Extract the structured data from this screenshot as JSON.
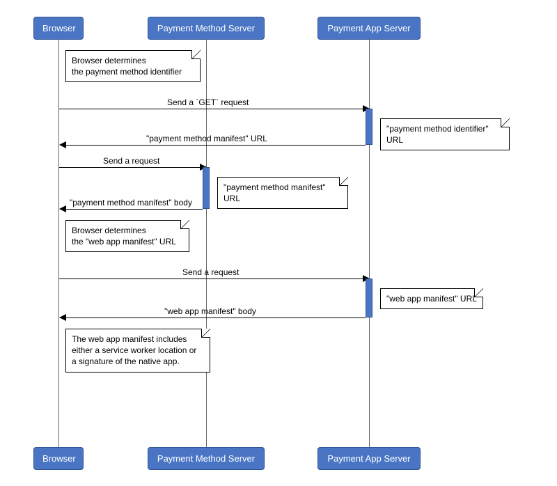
{
  "participants": {
    "p1": "Browser",
    "p2": "Payment Method Server",
    "p3": "Payment App Server"
  },
  "notes": {
    "n1": "Browser determines\nthe payment method identifier",
    "n2": "\"payment method identifier\" URL",
    "n3": "\"payment method manifest\" URL",
    "n4": "Browser determines\nthe \"web app manifest\" URL",
    "n5": "\"web app manifest\" URL",
    "n6": "The web app manifest includes\neither a service worker location or\na signature of the native app."
  },
  "messages": {
    "m1": "Send a `GET` request",
    "m2": "\"payment method manifest\" URL",
    "m3": "Send a request",
    "m4": "\"payment method manifest\" body",
    "m5": "Send a request",
    "m6": "\"web app manifest\" body"
  }
}
